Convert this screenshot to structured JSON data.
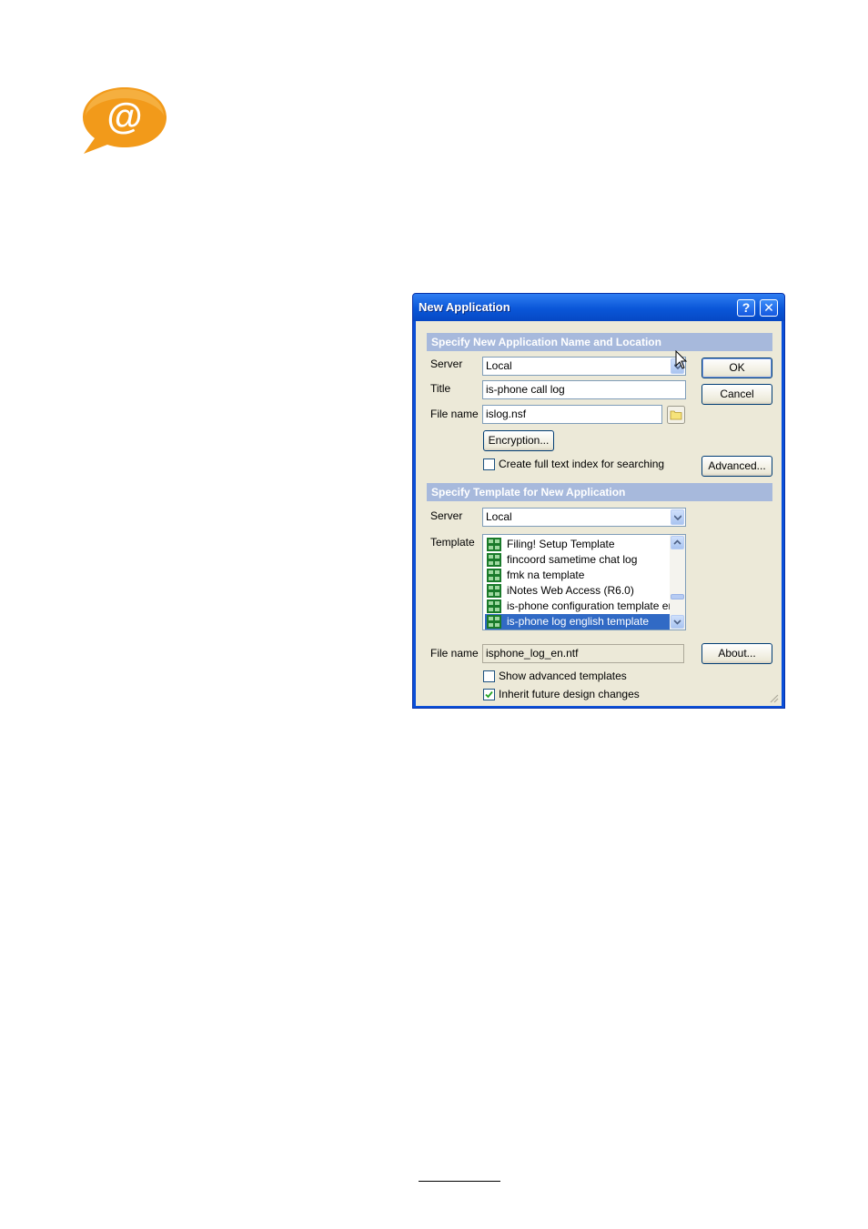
{
  "logo": {
    "symbol": "@",
    "color": "#f29a1a"
  },
  "dialog": {
    "title": "New Application",
    "help_label": "?",
    "close_label": "✕",
    "section1": {
      "header": "Specify New Application Name and Location",
      "server_label": "Server",
      "server_value": "Local",
      "title_label": "Title",
      "title_value": "is-phone call log",
      "filename_label": "File name",
      "filename_value": "islog.nsf",
      "encryption_button": "Encryption...",
      "fulltext_checkbox": {
        "label": "Create full text index for searching",
        "checked": false
      }
    },
    "buttons": {
      "ok": "OK",
      "cancel": "Cancel",
      "advanced": "Advanced...",
      "about": "About..."
    },
    "section2": {
      "header": "Specify Template for New Application",
      "server_label": "Server",
      "server_value": "Local",
      "template_label": "Template",
      "templates": [
        {
          "label": "Filing! Setup Template",
          "selected": false
        },
        {
          "label": "fincoord sametime chat log",
          "selected": false
        },
        {
          "label": "fmk na template",
          "selected": false
        },
        {
          "label": "iNotes Web Access (R6.0)",
          "selected": false
        },
        {
          "label": "is-phone configuration template eng",
          "selected": false
        },
        {
          "label": "is-phone log english template",
          "selected": true
        }
      ],
      "filename_label": "File name",
      "filename_value": "isphone_log_en.ntf",
      "show_advanced": {
        "label": "Show advanced templates",
        "checked": false
      },
      "inherit": {
        "label": "Inherit future design changes",
        "checked": true
      }
    }
  },
  "colors": {
    "titlebar": "#0a56d8",
    "section_bar": "#a7b9dc",
    "dialog_face": "#ece9d8",
    "selection": "#316ac5",
    "template_icon": "#1a7a2a"
  }
}
